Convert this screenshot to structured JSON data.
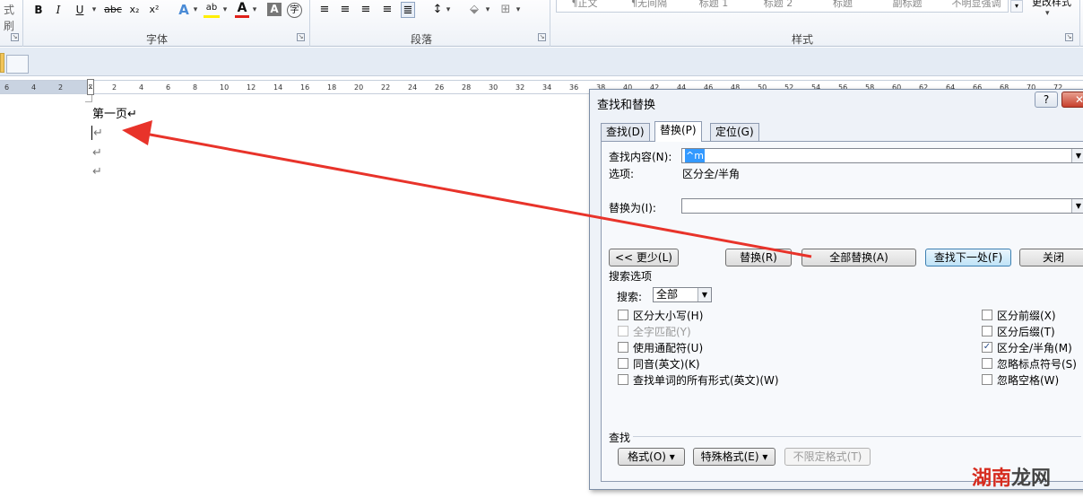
{
  "ribbon": {
    "left_cut_label": "式刷",
    "font_buttons": [
      "B",
      "I",
      "U",
      "abc",
      "x₂",
      "x²"
    ],
    "font_group_label": "字体",
    "paragraph_group_label": "段落",
    "styles_group_label": "样式",
    "style_gallery": [
      "¶正文",
      "¶无间隔",
      "标题 1",
      "标题 2",
      "标题",
      "副标题",
      "不明显强调"
    ],
    "change_styles_label": "更改样式"
  },
  "ruler": {
    "ticks": [
      "6",
      "4",
      "2",
      "",
      "2",
      "4",
      "6",
      "8",
      "10",
      "12",
      "14",
      "16",
      "18",
      "20",
      "22",
      "24",
      "26",
      "28",
      "30",
      "32",
      "34",
      "36",
      "38",
      "40",
      "42",
      "44",
      "46",
      "48",
      "50",
      "52",
      "54",
      "56",
      "58",
      "60",
      "62",
      "64",
      "66",
      "68",
      "70",
      "72"
    ]
  },
  "document": {
    "paragraphs": [
      "第一页↵",
      "↵",
      "↵",
      "↵"
    ]
  },
  "dialog": {
    "title": "查找和替换",
    "help_label": "?",
    "close_label": "✕",
    "tabs": [
      "查找(D)",
      "替换(P)",
      "定位(G)"
    ],
    "active_tab": 1,
    "find_label": "查找内容(N):",
    "find_value": "^m",
    "options_label": "选项:",
    "options_value": "区分全/半角",
    "replace_label": "替换为(I):",
    "replace_value": "",
    "less_button": "<< 更少(L)",
    "replace_button": "替换(R)",
    "replace_all_button": "全部替换(A)",
    "find_next_button": "查找下一处(F)",
    "close_button": "关闭",
    "search_options_label": "搜索选项",
    "search_label": "搜索:",
    "search_value": "全部",
    "left_options": [
      {
        "label": "区分大小写(H)",
        "checked": false,
        "disabled": false
      },
      {
        "label": "全字匹配(Y)",
        "checked": false,
        "disabled": true
      },
      {
        "label": "使用通配符(U)",
        "checked": false,
        "disabled": false
      },
      {
        "label": "同音(英文)(K)",
        "checked": false,
        "disabled": false
      },
      {
        "label": "查找单词的所有形式(英文)(W)",
        "checked": false,
        "disabled": false
      }
    ],
    "right_options": [
      {
        "label": "区分前缀(X)",
        "checked": false,
        "disabled": false
      },
      {
        "label": "区分后缀(T)",
        "checked": false,
        "disabled": false
      },
      {
        "label": "区分全/半角(M)",
        "checked": true,
        "disabled": false
      },
      {
        "label": "忽略标点符号(S)",
        "checked": false,
        "disabled": false
      },
      {
        "label": "忽略空格(W)",
        "checked": false,
        "disabled": false
      }
    ],
    "find_section_label": "查找",
    "format_button": "格式(O) ▾",
    "special_button": "特殊格式(E) ▾",
    "no_format_button": "不限定格式(T)"
  },
  "watermark": {
    "part1": "湖南",
    "part2": "龙网"
  },
  "colors": {
    "arrow": "#e8332a",
    "accent": "#3c7fb1"
  }
}
